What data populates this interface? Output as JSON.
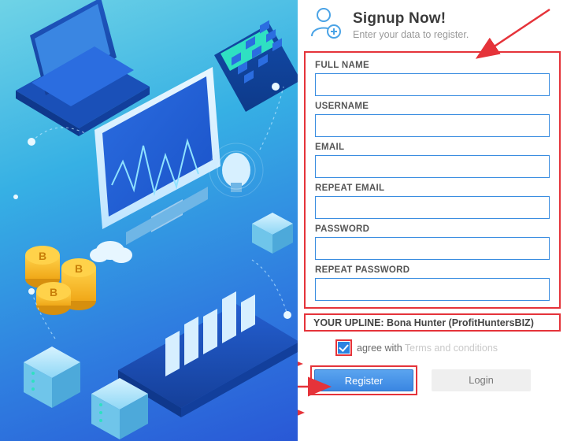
{
  "header": {
    "title": "Signup Now!",
    "subtitle": "Enter your data to register."
  },
  "form": {
    "fields": {
      "fullname_label": "FULL NAME",
      "username_label": "USERNAME",
      "email_label": "EMAIL",
      "repeat_email_label": "REPEAT EMAIL",
      "password_label": "PASSWORD",
      "repeat_password_label": "REPEAT PASSWORD"
    }
  },
  "upline": {
    "text": "YOUR UPLINE: Bona Hunter (ProfitHuntersBIZ)"
  },
  "agree": {
    "label": "agree with ",
    "terms": "Terms and conditions"
  },
  "buttons": {
    "register": "Register",
    "login": "Login"
  }
}
